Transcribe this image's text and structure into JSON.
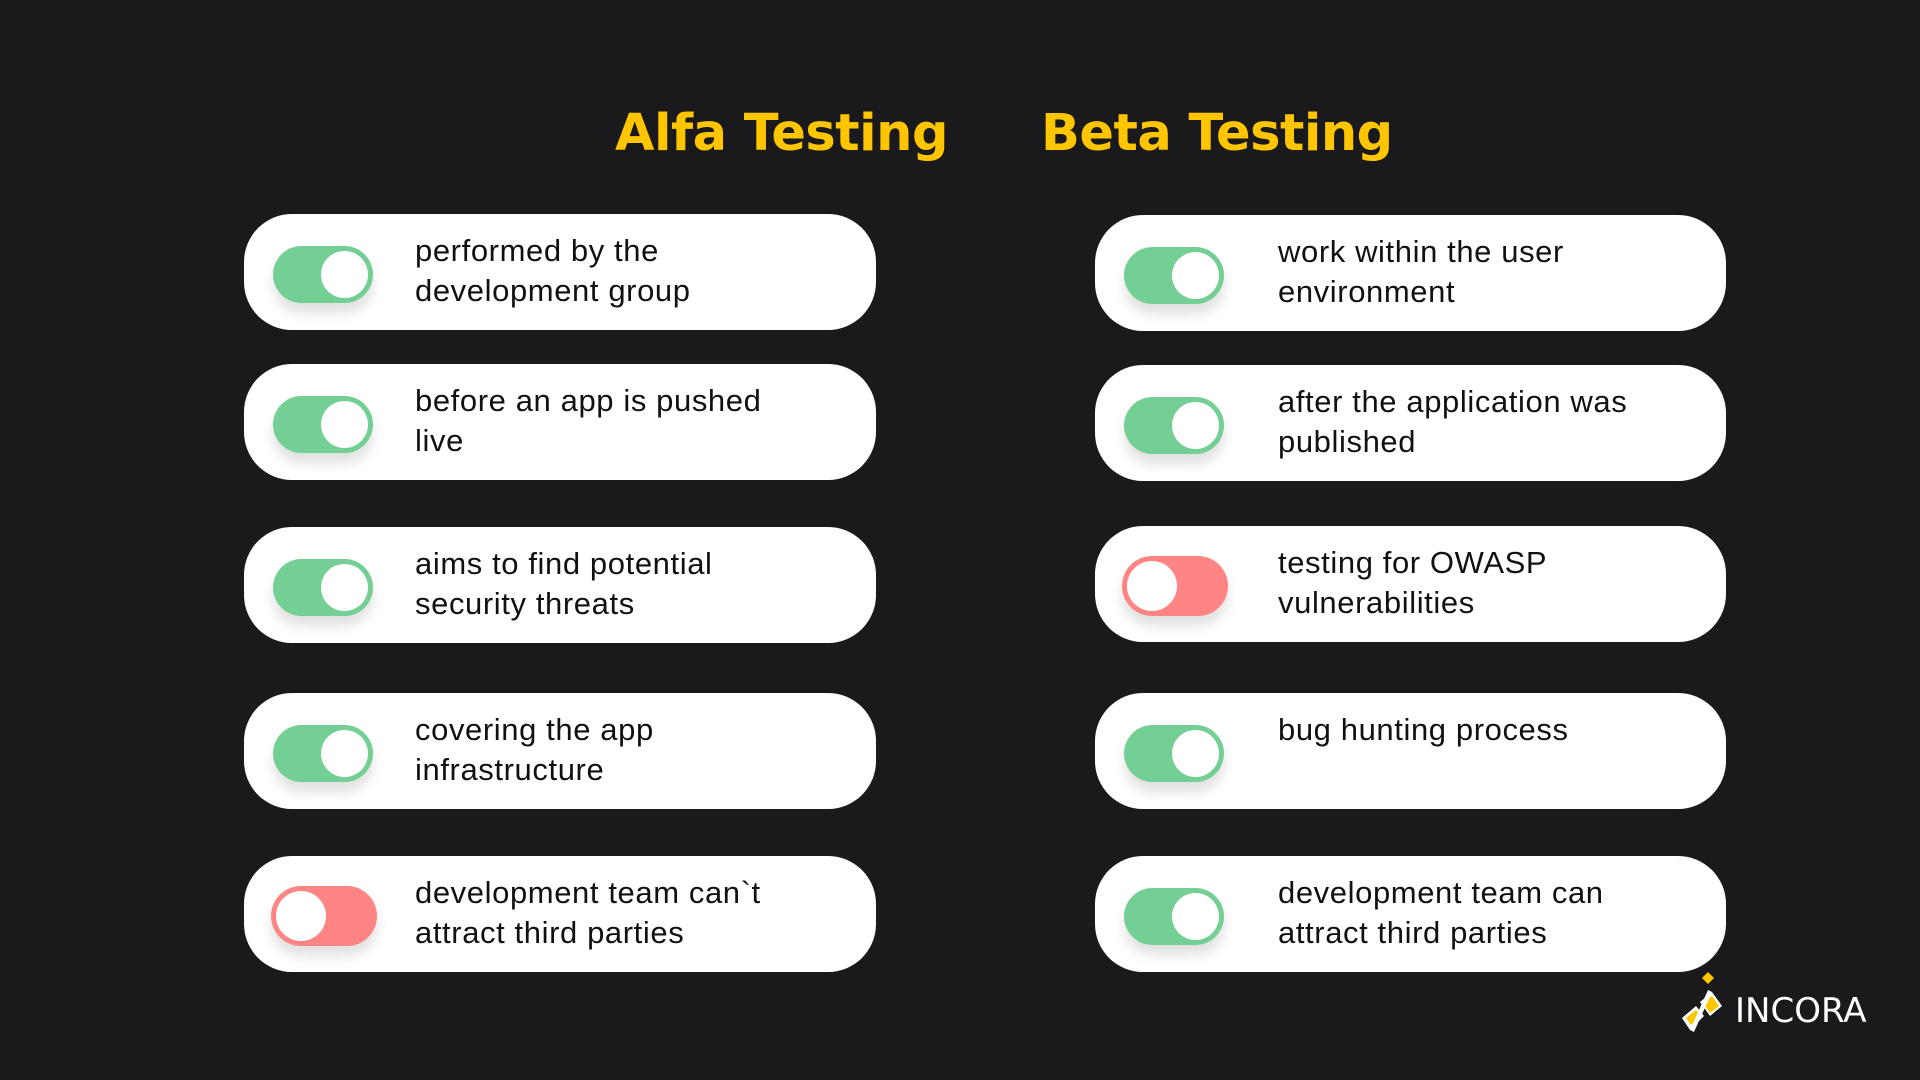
{
  "headers": {
    "alfa": "Alfa Testing",
    "beta": "Beta Testing"
  },
  "colors": {
    "background": "#1a1a1c",
    "title": "#ffc600",
    "toggle_on": "#74cf94",
    "toggle_off": "#ff8484",
    "card": "#ffffff"
  },
  "alfa": {
    "items": [
      {
        "text": "performed by the\ndevelopment group",
        "state": "on"
      },
      {
        "text": "before an app is pushed\nlive",
        "state": "on"
      },
      {
        "text": "aims to find potential\nsecurity threats",
        "state": "on"
      },
      {
        "text": "covering the app\ninfrastructure",
        "state": "on"
      },
      {
        "text": "development team can`t\nattract third parties",
        "state": "off"
      }
    ]
  },
  "beta": {
    "items": [
      {
        "text": "work within the user\nenvironment",
        "state": "on"
      },
      {
        "text": "after the application was\npublished",
        "state": "on"
      },
      {
        "text": "testing for OWASP\nvulnerabilities",
        "state": "off"
      },
      {
        "text": "bug hunting process",
        "state": "on"
      },
      {
        "text": "development team can\nattract third parties",
        "state": "on"
      }
    ]
  },
  "logo": {
    "text": "INCORA",
    "icon": "incora-logo-icon"
  }
}
